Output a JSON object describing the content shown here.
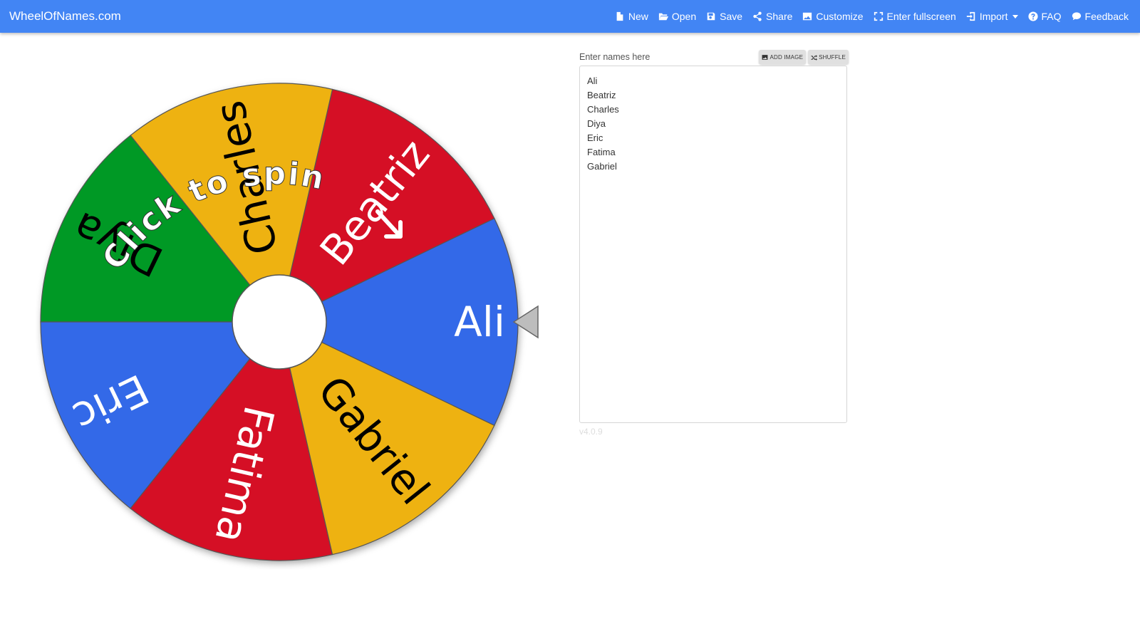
{
  "navbar": {
    "brand": "WheelOfNames.com",
    "items": [
      {
        "label": "New",
        "icon": "file-icon"
      },
      {
        "label": "Open",
        "icon": "folder-open-icon"
      },
      {
        "label": "Save",
        "icon": "save-icon"
      },
      {
        "label": "Share",
        "icon": "share-icon"
      },
      {
        "label": "Customize",
        "icon": "image-icon"
      },
      {
        "label": "Enter fullscreen",
        "icon": "fullscreen-icon"
      },
      {
        "label": "Import",
        "icon": "import-icon"
      },
      {
        "label": "FAQ",
        "icon": "question-icon"
      },
      {
        "label": "Feedback",
        "icon": "comment-icon"
      }
    ],
    "color": "#4285f4"
  },
  "wheel": {
    "spin_prompt": "Click to spin",
    "segments": [
      {
        "name": "Ali",
        "color": "#3369e8",
        "text_color": "#ffffff"
      },
      {
        "name": "Beatriz",
        "color": "#d50f25",
        "text_color": "#ffffff"
      },
      {
        "name": "Charles",
        "color": "#eeb211",
        "text_color": "#000000"
      },
      {
        "name": "Diya",
        "color": "#009925",
        "text_color": "#000000"
      },
      {
        "name": "Eric",
        "color": "#3369e8",
        "text_color": "#ffffff"
      },
      {
        "name": "Fatima",
        "color": "#d50f25",
        "text_color": "#ffffff"
      },
      {
        "name": "Gabriel",
        "color": "#eeb211",
        "text_color": "#000000"
      }
    ]
  },
  "names_panel": {
    "label": "Enter names here",
    "add_image_label": "ADD IMAGE",
    "shuffle_label": "SHUFFLE",
    "names": [
      "Ali",
      "Beatriz",
      "Charles",
      "Diya",
      "Eric",
      "Fatima",
      "Gabriel"
    ],
    "version": "v4.0.9"
  }
}
